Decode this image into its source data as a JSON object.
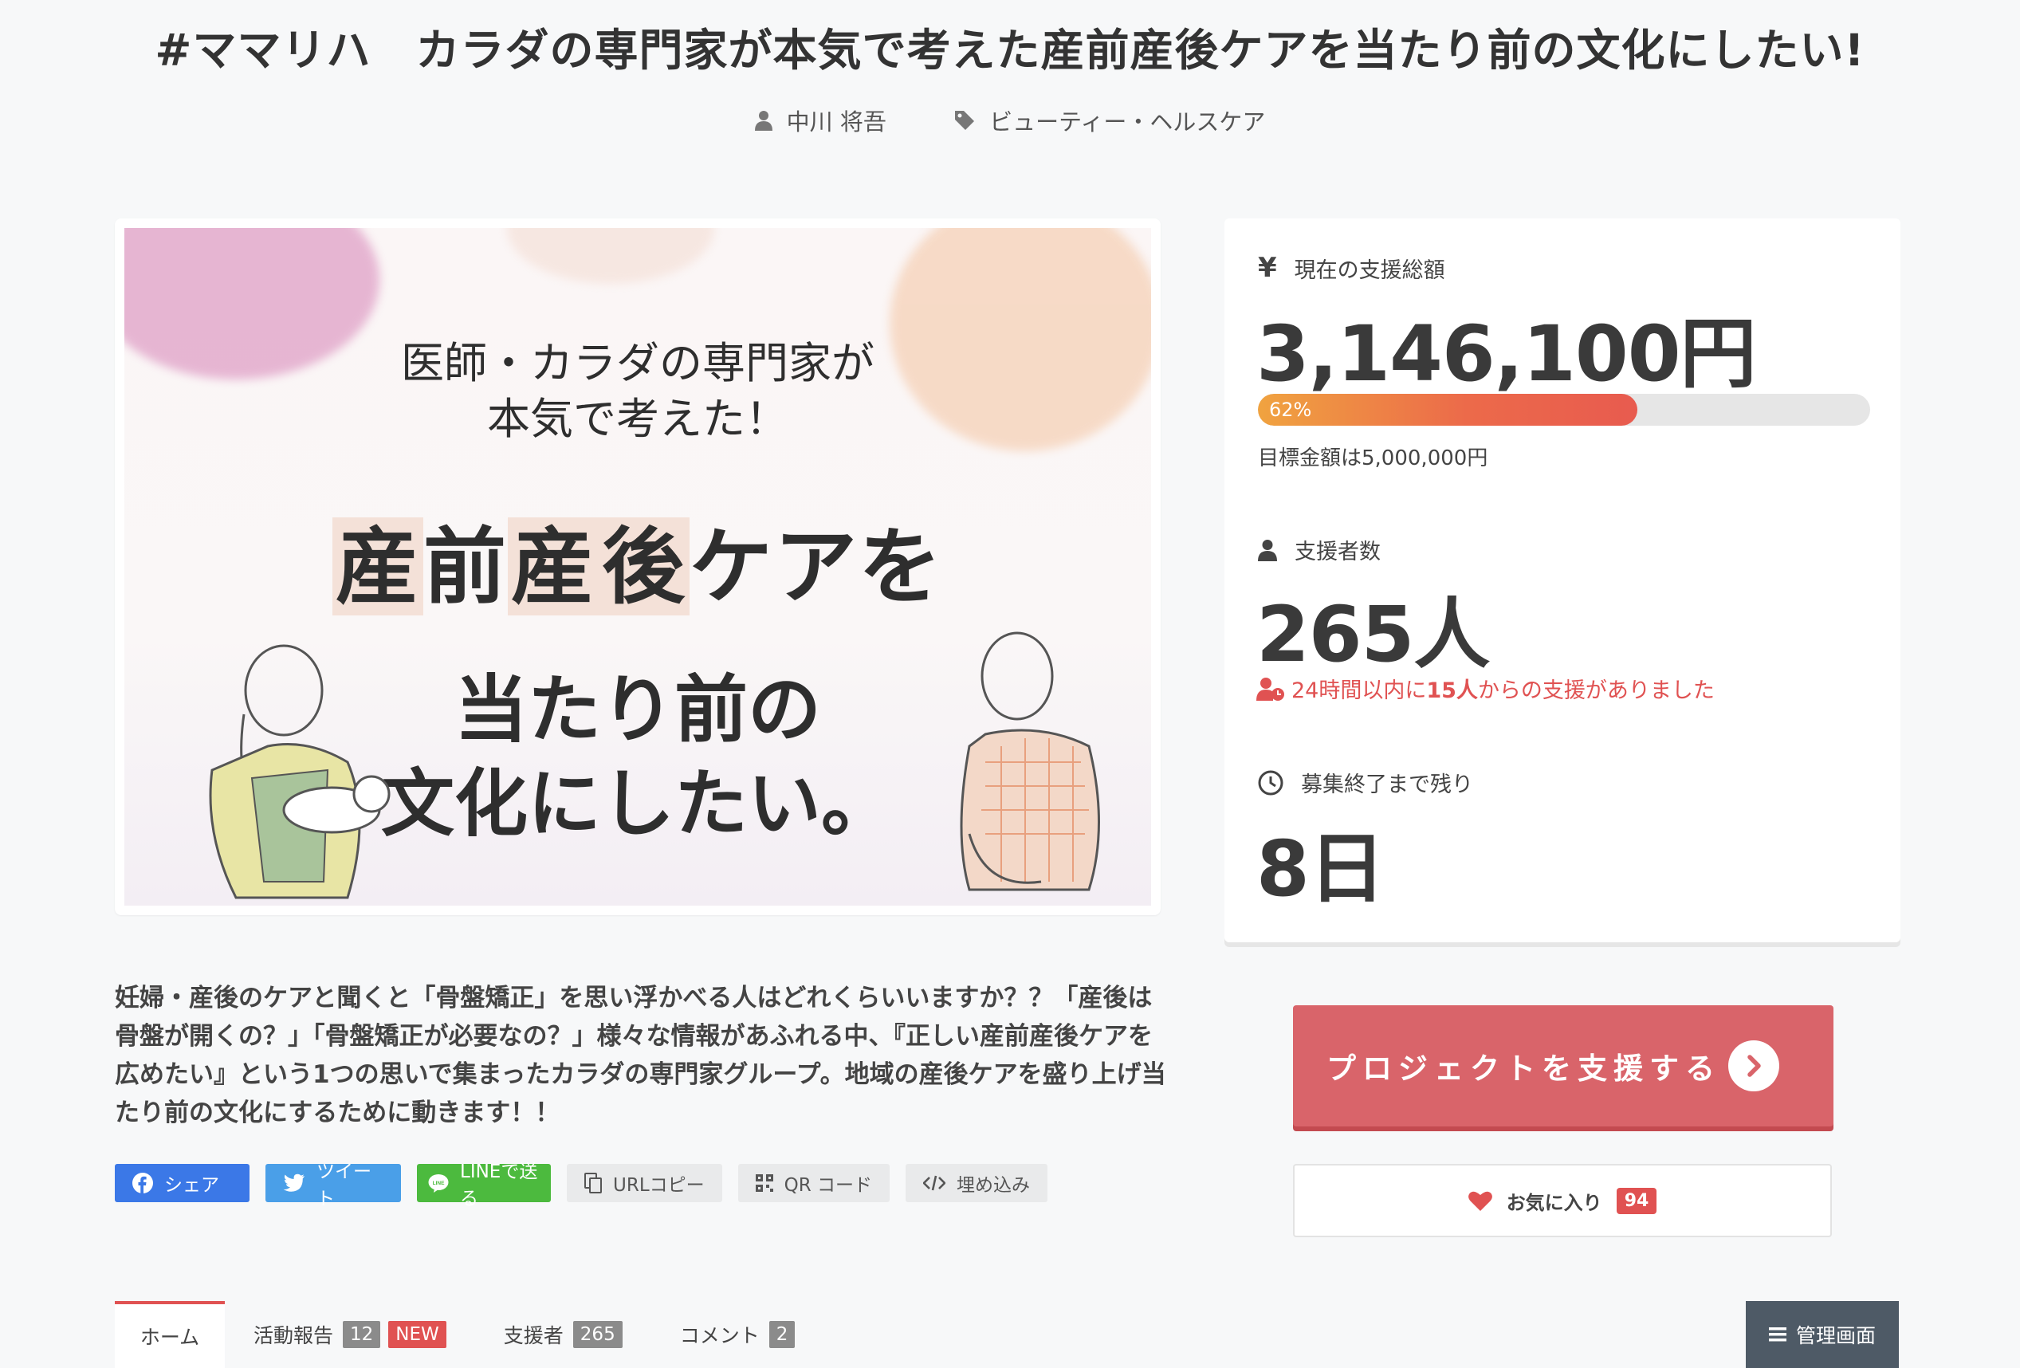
{
  "project": {
    "title": "#ママリハ　カラダの専門家が本気で考えた産前産後ケアを当たり前の文化にしたい!",
    "owner": "中川 将吾",
    "category": "ビューティー・ヘルスケア"
  },
  "hero": {
    "sub_line1": "医師・カラダの専門家が",
    "sub_line2": "本気で考えた！",
    "main_a": "産",
    "main_b": "前",
    "main_c": "産",
    "main_d": "後",
    "main_e": "ケアを",
    "main2_line1": "当たり前の",
    "main2_line2": "文化にしたい。"
  },
  "description": "妊婦・産後のケアと聞くと「骨盤矯正」を思い浮かべる人はどれくらいいますか？？「産後は骨盤が開くの？」「骨盤矯正が必要なの？」様々な情報があふれる中、『正しい産前産後ケアを広めたい』という1つの思いで集まったカラダの専門家グループ。地域の産後ケアを盛り上げ当たり前の文化にするために動きます！！",
  "share": {
    "facebook": "シェア",
    "twitter": "ツイート",
    "line": "LINEで送る",
    "url_copy": "URLコピー",
    "qr": "QR コード",
    "embed": "埋め込み"
  },
  "stats": {
    "amount_label": "現在の支援総額",
    "amount": "3,146,100円",
    "progress_percent": 62,
    "progress_label": "62%",
    "goal": "目標金額は5,000,000円",
    "supporters_label": "支援者数",
    "supporters": "265人",
    "recent_prefix": "24時間以内に",
    "recent_count": "15人",
    "recent_suffix": "からの支援がありました",
    "remaining_label": "募集終了まで残り",
    "remaining": "8日"
  },
  "actions": {
    "support": "プロジェクトを支援する",
    "favorite": "お気に入り",
    "favorite_count": "94"
  },
  "tabs": {
    "home": "ホーム",
    "reports": "活動報告",
    "reports_count": "12",
    "reports_new": "NEW",
    "supporters": "支援者",
    "supporters_count": "265",
    "comments": "コメント",
    "comments_count": "2",
    "admin": "管理画面"
  },
  "colors": {
    "accent": "#d9646a",
    "alert": "#e05252",
    "facebook": "#3b78e7",
    "twitter": "#4a9fe8",
    "line": "#4cba3e",
    "admin": "#4e5a66"
  }
}
